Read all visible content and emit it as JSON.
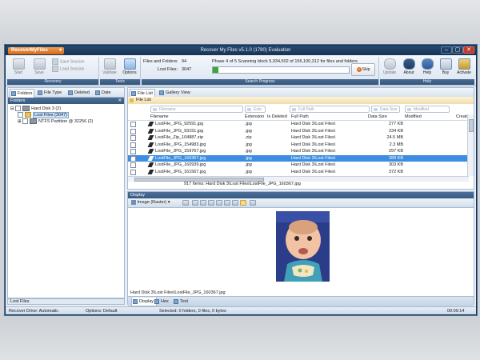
{
  "app": {
    "menu_label": "RecoverMyFiles",
    "window_title": "Recover My Files v5.1.0 (1780) Evaluation",
    "window_buttons": [
      "–",
      "▢",
      "✕"
    ]
  },
  "ribbon": {
    "recovery": {
      "label": "Recovery",
      "start": "Start",
      "save": "Save",
      "save_session": "Save Session",
      "load_session": "Load Session"
    },
    "tools": {
      "label": "Tools",
      "validate": "Validate",
      "options": "Options"
    },
    "search": {
      "label": "Search Progress",
      "files_folders_label": "Files and Folders:",
      "files_folders_value": "94",
      "lost_files_label": "Lost Files:",
      "lost_files_value": "3047",
      "phase_text": "Phase 4 of 5 Scanning block 5,934,502 of 156,100,312 for files and folders",
      "progress": 0.04,
      "skip": "Skip"
    },
    "help": {
      "label": "Help",
      "update": "Update",
      "about": "About",
      "help": "Help",
      "buy": "Buy",
      "activate": "Activate"
    }
  },
  "left_panel": {
    "tabs": [
      "Folders",
      "File Type",
      "Deleted",
      "Date"
    ],
    "header": "Folders",
    "tree": [
      {
        "label": "Hard Disk 3 (2)"
      },
      {
        "label": "Lost Files (3047)"
      },
      {
        "label": "NTFS Partition @ 32256 (2)"
      }
    ],
    "footer": "Lost Files"
  },
  "file_list": {
    "tabs": [
      "File List",
      "Gallery View"
    ],
    "header": "File List",
    "filters": [
      "Filename",
      "Exte",
      "Full Path",
      "Data Size",
      "Modified"
    ],
    "columns": [
      "Filename",
      "Extension",
      "Is Deleted",
      "Full Path",
      "Data Size",
      "Modified",
      "Created"
    ],
    "rows": [
      {
        "name": "LostFile_JPG_92591.jpg",
        "ext": ".jpg",
        "path": "Hard Disk 3\\Lost Files\\",
        "size": "277 KB"
      },
      {
        "name": "LostFile_JPG_93151.jpg",
        "ext": ".jpg",
        "path": "Hard Disk 3\\Lost Files\\",
        "size": "234 KB"
      },
      {
        "name": "LostFile_Zip_104887.zip",
        "ext": ".zip",
        "path": "Hard Disk 3\\Lost Files\\",
        "size": "24.5 MB"
      },
      {
        "name": "LostFile_JPG_154983.jpg",
        "ext": ".jpg",
        "path": "Hard Disk 3\\Lost Files\\",
        "size": "2.3 MB"
      },
      {
        "name": "LostFile_JPG_159767.jpg",
        "ext": ".jpg",
        "path": "Hard Disk 3\\Lost Files\\",
        "size": "297 KB"
      },
      {
        "name": "LostFile_JPG_160367.jpg",
        "ext": ".jpg",
        "path": "Hard Disk 3\\Lost Files\\",
        "size": "289 KB",
        "selected": true
      },
      {
        "name": "LostFile_JPG_160939.jpg",
        "ext": ".jpg",
        "path": "Hard Disk 3\\Lost Files\\",
        "size": "303 KB"
      },
      {
        "name": "LostFile_JPG_161567.jpg",
        "ext": ".jpg",
        "path": "Hard Disk 3\\Lost Files\\",
        "size": "372 KB"
      }
    ],
    "status": "917 Items: Hard Disk 3\\Lost Files\\LostFile_JPG_160367.jpg"
  },
  "display": {
    "header": "Display",
    "mode": "Image (Raster)",
    "path": "Hard Disk 3\\Lost Files\\LostFile_JPG_160367.jpg",
    "tabs": [
      "Display",
      "Hex",
      "Text"
    ]
  },
  "statusbar": {
    "drive": "Recover Drive: Automatic",
    "options": "Options: Default",
    "selected": "Selected: 0 folders, 0 files, 0 bytes",
    "time": "00:09:14"
  }
}
